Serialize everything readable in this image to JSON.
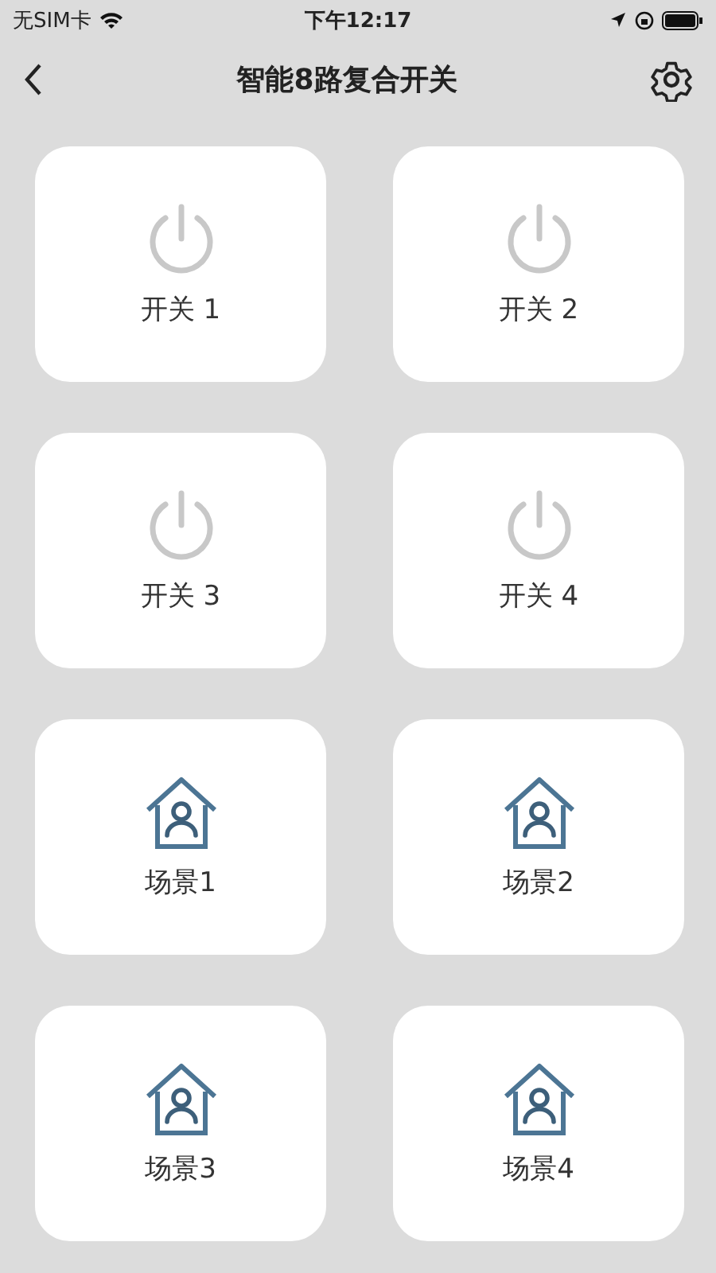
{
  "status_bar": {
    "carrier": "无SIM卡",
    "time": "下午12:17"
  },
  "nav": {
    "title": "智能8路复合开关"
  },
  "tiles": [
    {
      "kind": "switch",
      "label": "开关 1",
      "on": false
    },
    {
      "kind": "switch",
      "label": "开关 2",
      "on": false
    },
    {
      "kind": "switch",
      "label": "开关 3",
      "on": false
    },
    {
      "kind": "switch",
      "label": "开关 4",
      "on": false
    },
    {
      "kind": "scene",
      "label": "场景1"
    },
    {
      "kind": "scene",
      "label": "场景2"
    },
    {
      "kind": "scene",
      "label": "场景3"
    },
    {
      "kind": "scene",
      "label": "场景4"
    }
  ]
}
